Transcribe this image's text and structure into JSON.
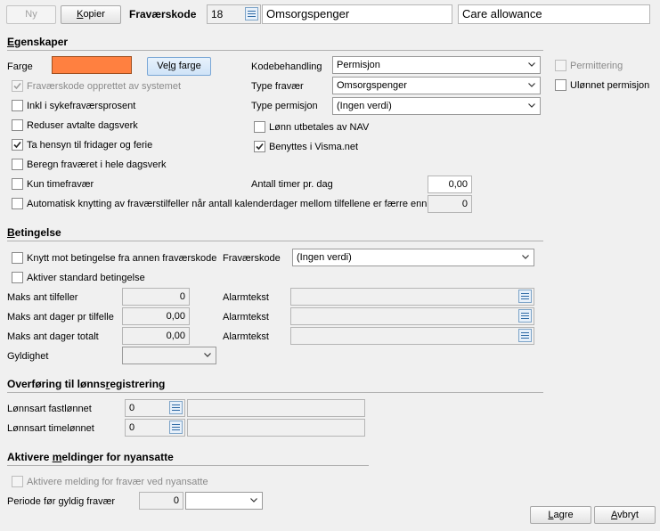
{
  "toolbar": {
    "new_label": "Ny",
    "copy_label": "Kopier",
    "code_label": "Fraværskode",
    "code_value": "18",
    "name_value": "Omsorgspenger",
    "name_en_value": "Care allowance"
  },
  "egenskaper": {
    "title": "Egenskaper",
    "color_label": "Farge",
    "color_value": "#ff8040",
    "choose_color_label": "Velg farge",
    "created_by_system_label": "Fraværskode opprettet av systemet",
    "incl_sick_pct_label": "Inkl i sykefraværsprosent",
    "reduce_workdays_label": "Reduser avtalte dagsverk",
    "holidays_label": "Ta hensyn til fridager og ferie",
    "whole_days_label": "Beregn fraværet i hele dagsverk",
    "hours_only_label": "Kun timefravær",
    "auto_link_label": "Automatisk knytting av fraværstilfeller når antall kalenderdager mellom tilfellene er færre enn",
    "auto_link_value": "0",
    "code_handling_label": "Kodebehandling",
    "code_handling_value": "Permisjon",
    "absence_type_label": "Type fravær",
    "absence_type_value": "Omsorgspenger",
    "leave_type_label": "Type permisjon",
    "leave_type_value": "(Ingen verdi)",
    "nav_pay_label": "Lønn utbetales av NAV",
    "visma_label": "Benyttes i Visma.net",
    "hours_per_day_label": "Antall timer pr. dag",
    "hours_per_day_value": "0,00",
    "layoff_label": "Permittering",
    "unpaid_leave_label": "Ulønnet permisjon",
    "checks": {
      "created_by_system": true,
      "incl_sick_pct": false,
      "reduce_workdays": false,
      "holidays": true,
      "whole_days": false,
      "hours_only": false,
      "auto_link": false,
      "nav_pay": false,
      "visma": true,
      "layoff": false,
      "unpaid_leave": false
    }
  },
  "betingelse": {
    "title": "Betingelse",
    "link_condition_label": "Knytt mot betingelse fra annen fraværskode",
    "code_label": "Fraværskode",
    "code_value": "(Ingen verdi)",
    "activate_standard_label": "Aktiver standard betingelse",
    "max_cases_label": "Maks ant tilfeller",
    "max_cases_value": "0",
    "max_days_per_case_label": "Maks ant dager pr tilfelle",
    "max_days_per_case_value": "0,00",
    "max_days_total_label": "Maks ant dager totalt",
    "max_days_total_value": "0,00",
    "alarm_label_1": "Alarmtekst",
    "alarm_label_2": "Alarmtekst",
    "alarm_label_3": "Alarmtekst",
    "validity_label": "Gyldighet"
  },
  "lonn": {
    "title": "Overføring til lønnsregistrering",
    "fixed_label": "Lønnsart fastlønnet",
    "fixed_value": "0",
    "hourly_label": "Lønnsart timelønnet",
    "hourly_value": "0"
  },
  "meldinger": {
    "title": "Aktivere meldinger for nyansatte",
    "activate_label": "Aktivere melding for fravær ved nyansatte",
    "period_label": "Periode før gyldig fravær",
    "period_value": "0"
  },
  "footer": {
    "save_label": "Lagre",
    "cancel_label": "Avbryt"
  },
  "icons": {
    "lookup": "lookup-list-icon",
    "dropdown": "chevron-down-icon",
    "check": "check-icon"
  }
}
